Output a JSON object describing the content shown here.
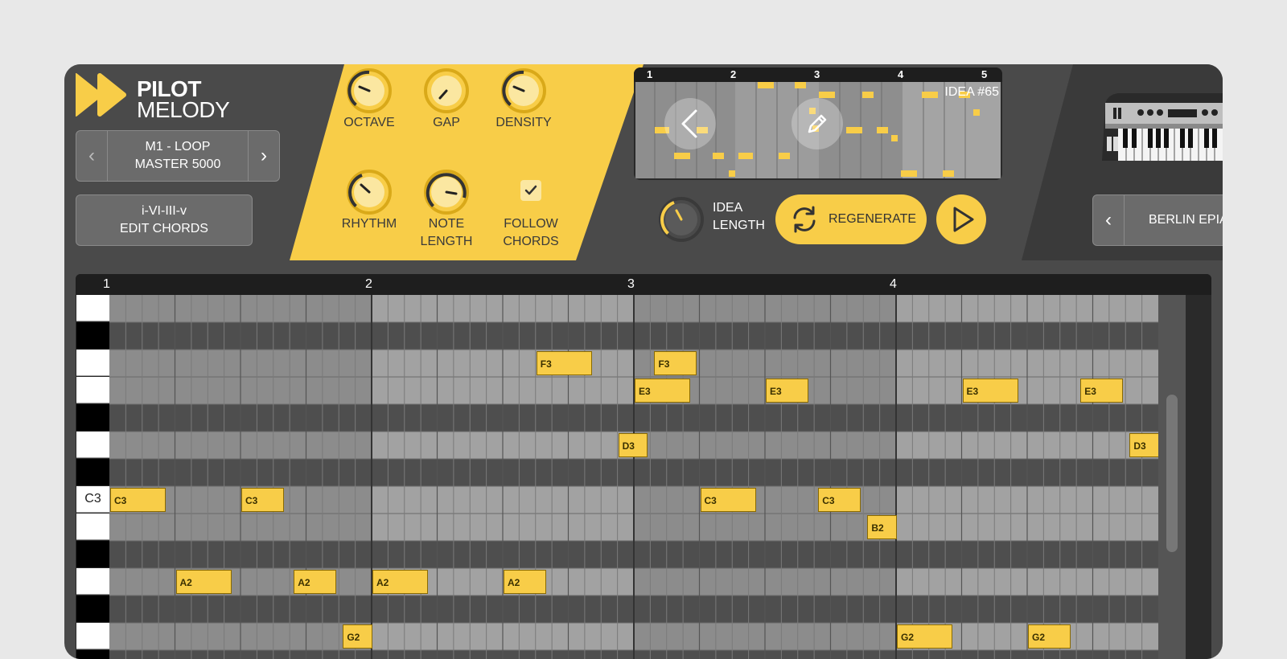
{
  "app": {
    "logo_line1": "PILOT",
    "logo_line2": "MELODY"
  },
  "preset": {
    "line1": "M1 - LOOP",
    "line2": "MASTER 5000",
    "prev": "‹",
    "next": "›"
  },
  "chords": {
    "line1": "i-VI-III-v",
    "line2": "EDIT CHORDS"
  },
  "knobs": {
    "octave": "OCTAVE",
    "gap": "GAP",
    "density": "DENSITY",
    "rhythm": "RHYTHM",
    "note_length_1": "NOTE",
    "note_length_2": "LENGTH",
    "follow_1": "FOLLOW",
    "follow_2": "CHORDS"
  },
  "idea": {
    "ruler": [
      "1",
      "2",
      "3",
      "4",
      "5"
    ],
    "number": "IDEA #65",
    "length_1": "IDEA",
    "length_2": "LENGTH"
  },
  "actions": {
    "regenerate": "REGENERATE"
  },
  "instrument": {
    "name": "BERLIN EPIANO",
    "prev": "‹"
  },
  "roll": {
    "ruler": [
      "1",
      "2",
      "3",
      "4"
    ],
    "key_label": "C3",
    "notes": [
      {
        "label": "F3",
        "row": 2,
        "start": 6.5,
        "len": 0.85
      },
      {
        "label": "F3",
        "row": 2,
        "start": 8.3,
        "len": 0.65
      },
      {
        "label": "E3",
        "row": 3,
        "start": 8.0,
        "len": 0.85
      },
      {
        "label": "E3",
        "row": 3,
        "start": 10.0,
        "len": 0.65
      },
      {
        "label": "E3",
        "row": 3,
        "start": 13.0,
        "len": 0.85
      },
      {
        "label": "E3",
        "row": 3,
        "start": 14.8,
        "len": 0.65
      },
      {
        "label": "D3",
        "row": 5,
        "start": 7.75,
        "len": 0.45
      },
      {
        "label": "D3",
        "row": 5,
        "start": 15.55,
        "len": 0.45
      },
      {
        "label": "C3",
        "row": 7,
        "start": 0.0,
        "len": 0.85
      },
      {
        "label": "C3",
        "row": 7,
        "start": 2.0,
        "len": 0.65
      },
      {
        "label": "C3",
        "row": 7,
        "start": 9.0,
        "len": 0.85
      },
      {
        "label": "C3",
        "row": 7,
        "start": 10.8,
        "len": 0.65
      },
      {
        "label": "B2",
        "row": 8,
        "start": 11.55,
        "len": 0.45
      },
      {
        "label": "A2",
        "row": 10,
        "start": 1.0,
        "len": 0.85
      },
      {
        "label": "A2",
        "row": 10,
        "start": 2.8,
        "len": 0.65
      },
      {
        "label": "A2",
        "row": 10,
        "start": 4.0,
        "len": 0.85
      },
      {
        "label": "A2",
        "row": 10,
        "start": 6.0,
        "len": 0.65
      },
      {
        "label": "G2",
        "row": 12,
        "start": 3.55,
        "len": 0.45
      },
      {
        "label": "G2",
        "row": 12,
        "start": 12.0,
        "len": 0.85
      },
      {
        "label": "G2",
        "row": 12,
        "start": 14.0,
        "len": 0.65
      }
    ]
  }
}
